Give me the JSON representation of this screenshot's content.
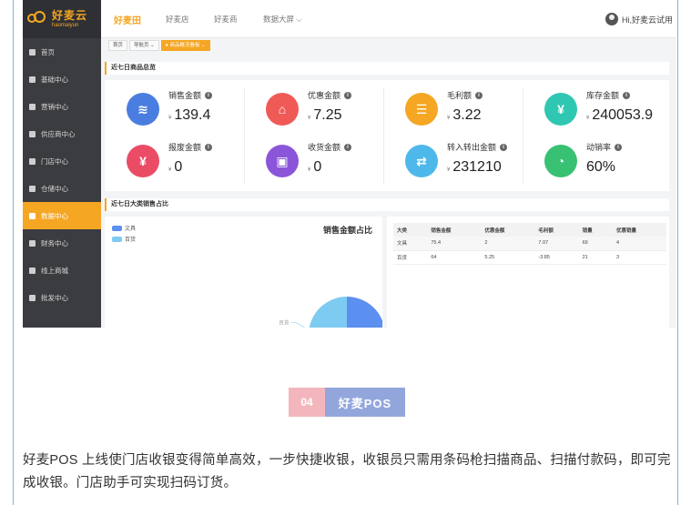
{
  "app": {
    "logo_cn": "好麦云",
    "logo_en": "haomaiyun"
  },
  "sidebar": {
    "items": [
      {
        "label": "首页"
      },
      {
        "label": "基础中心"
      },
      {
        "label": "营销中心"
      },
      {
        "label": "供应商中心"
      },
      {
        "label": "门店中心"
      },
      {
        "label": "仓储中心"
      },
      {
        "label": "数据中心",
        "active": true
      },
      {
        "label": "财务中心"
      },
      {
        "label": "线上商城"
      },
      {
        "label": "批发中心"
      }
    ]
  },
  "topbar": {
    "tabs": [
      {
        "label": "好麦田",
        "active": true
      },
      {
        "label": "好麦店"
      },
      {
        "label": "好麦商"
      },
      {
        "label": "数据大屏 ⌵"
      }
    ],
    "user": "Hi,好麦云试用"
  },
  "breadcrumbs": [
    "首页",
    "导航页 ⌄",
    "● 商品概况看板 ⌄"
  ],
  "overview": {
    "title": "近七日商品总览",
    "currency": "¥",
    "stats": [
      {
        "label": "销售金额",
        "value": "139.4",
        "has_currency": true,
        "color": "#4a7de0",
        "icon": "coins-icon",
        "glyph": "≋"
      },
      {
        "label": "优惠金额",
        "value": "7.25",
        "has_currency": true,
        "color": "#ef5a57",
        "icon": "tag-icon",
        "glyph": "⌂"
      },
      {
        "label": "毛利额",
        "value": "3.22",
        "has_currency": true,
        "color": "#f5a623",
        "icon": "clipboard-icon",
        "glyph": "☰"
      },
      {
        "label": "库存金额",
        "value": "240053.9",
        "has_currency": true,
        "color": "#2fc7b1",
        "icon": "warehouse-icon",
        "glyph": "¥"
      },
      {
        "label": "报废金额",
        "value": "0",
        "has_currency": true,
        "color": "#ea4c66",
        "icon": "money-bag-icon",
        "glyph": "¥"
      },
      {
        "label": "收货金额",
        "value": "0",
        "has_currency": true,
        "color": "#8b55d9",
        "icon": "box-icon",
        "glyph": "▣"
      },
      {
        "label": "转入转出金额",
        "value": "231210",
        "has_currency": true,
        "color": "#4fb8ea",
        "icon": "transfer-icon",
        "glyph": "⇄"
      },
      {
        "label": "动销率",
        "value": "60%",
        "has_currency": false,
        "color": "#38c172",
        "icon": "pie-icon",
        "glyph": "◔"
      }
    ]
  },
  "category": {
    "title": "近七日大类销售占比",
    "table": {
      "headers": [
        "大类",
        "销售金额",
        "优惠金额",
        "毛利额",
        "销量",
        "优惠销量"
      ],
      "rows": [
        [
          "文具",
          "75.4",
          "2",
          "7.07",
          "69",
          "4"
        ],
        [
          "百货",
          "64",
          "5.25",
          "-3.85",
          "21",
          "3"
        ]
      ]
    }
  },
  "chart_data": {
    "type": "pie",
    "title": "销售金额占比",
    "categories": [
      "文具",
      "百货"
    ],
    "values": [
      75.4,
      64
    ],
    "colors": [
      "#5b8ff0",
      "#7ecbf2"
    ],
    "slice_labels": [
      "",
      "百货"
    ],
    "legend_position": "top-left"
  },
  "badge": {
    "number": "04",
    "text": "好麦POS"
  },
  "description": "好麦POS 上线使门店收银变得简单高效，一步快捷收银，收银员只需用条码枪扫描商品、扫描付款码，即可完成收银。门店助手可实现扫码订货。"
}
